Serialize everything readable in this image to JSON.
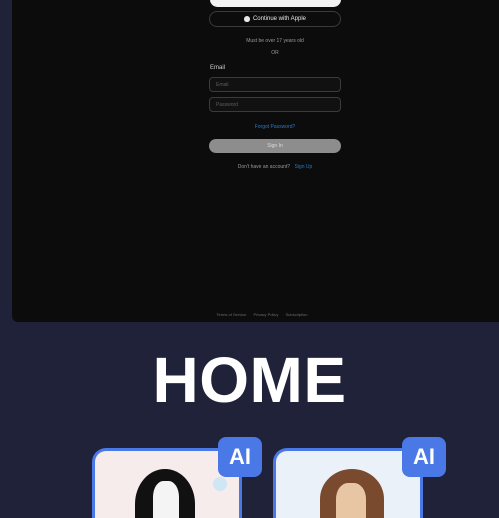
{
  "login": {
    "apple_button": "Continue with Apple",
    "divider_text": "Must be over 17 years old",
    "or_text": "OR",
    "email_label": "Email",
    "email_placeholder": "Email",
    "password_placeholder": "Password",
    "forgot_link": "Forgot Password?",
    "signin_button": "Sign In",
    "signup_prompt": "Don't have an account?",
    "signup_link": "Sign Up"
  },
  "footer": {
    "links": [
      "Terms of Service",
      "Privacy Policy",
      "Subscription"
    ]
  },
  "hero": {
    "title": "HOME"
  },
  "cards": [
    {
      "badge": "AI"
    },
    {
      "badge": "AI"
    }
  ],
  "colors": {
    "page_bg": "#1f2238",
    "panel_bg": "#0c0c0c",
    "accent": "#4a78e6",
    "link": "#2f76c4"
  },
  "icons": {
    "apple": "apple-icon"
  }
}
